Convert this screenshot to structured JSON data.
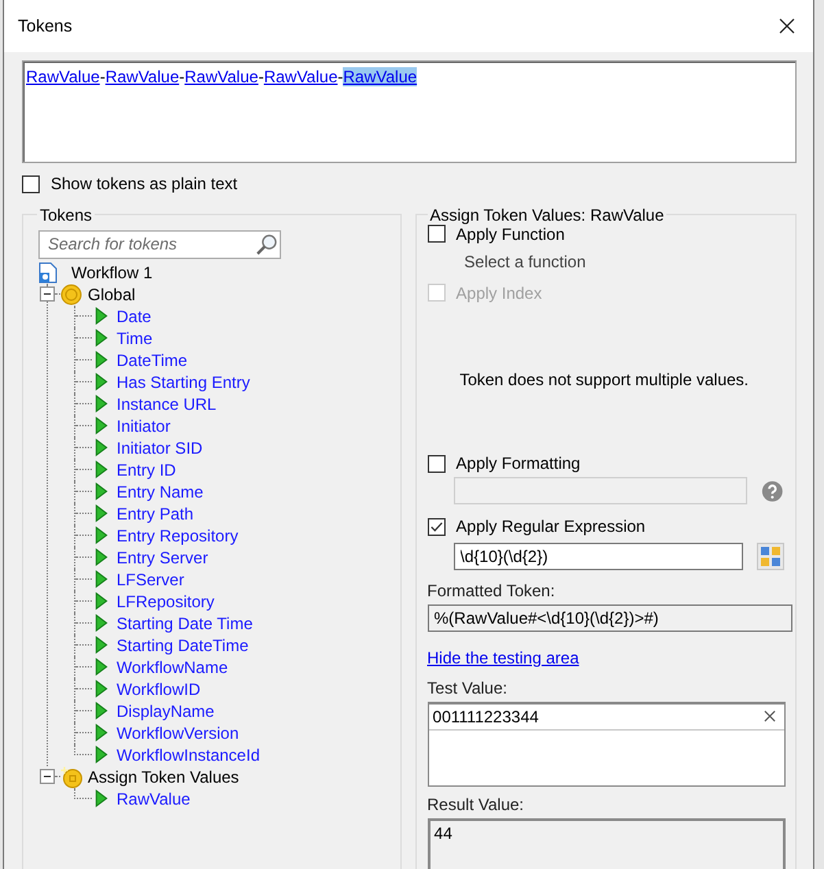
{
  "window": {
    "title": "Tokens"
  },
  "token_expression": [
    {
      "kind": "token",
      "text": "RawValue",
      "selected": false
    },
    {
      "kind": "separator",
      "text": "-"
    },
    {
      "kind": "token",
      "text": "RawValue",
      "selected": false
    },
    {
      "kind": "separator",
      "text": "-"
    },
    {
      "kind": "token",
      "text": "RawValue",
      "selected": false
    },
    {
      "kind": "separator",
      "text": "-"
    },
    {
      "kind": "token",
      "text": "RawValue",
      "selected": false
    },
    {
      "kind": "separator",
      "text": "-"
    },
    {
      "kind": "token",
      "text": "RawValue",
      "selected": true
    }
  ],
  "plain_text_option": {
    "label": "Show tokens as plain text",
    "checked": false
  },
  "tokens_panel": {
    "title": "Tokens",
    "search": {
      "placeholder": "Search for tokens"
    },
    "tree": [
      {
        "kind": "workflow",
        "label": "Workflow 1",
        "children": [
          {
            "kind": "global",
            "label": "Global",
            "expanded": true,
            "children": [
              {
                "kind": "token",
                "label": "Date"
              },
              {
                "kind": "token",
                "label": "Time"
              },
              {
                "kind": "token",
                "label": "DateTime"
              },
              {
                "kind": "token",
                "label": "Has Starting Entry"
              },
              {
                "kind": "token",
                "label": "Instance URL"
              },
              {
                "kind": "token",
                "label": "Initiator"
              },
              {
                "kind": "token",
                "label": "Initiator SID"
              },
              {
                "kind": "token",
                "label": "Entry ID"
              },
              {
                "kind": "token",
                "label": "Entry Name"
              },
              {
                "kind": "token",
                "label": "Entry Path"
              },
              {
                "kind": "token",
                "label": "Entry Repository"
              },
              {
                "kind": "token",
                "label": "Entry Server"
              },
              {
                "kind": "token",
                "label": "LFServer"
              },
              {
                "kind": "token",
                "label": "LFRepository"
              },
              {
                "kind": "token",
                "label": "Starting Date Time"
              },
              {
                "kind": "token",
                "label": "Starting DateTime"
              },
              {
                "kind": "token",
                "label": "WorkflowName"
              },
              {
                "kind": "token",
                "label": "WorkflowID"
              },
              {
                "kind": "token",
                "label": "DisplayName"
              },
              {
                "kind": "token",
                "label": "WorkflowVersion"
              },
              {
                "kind": "token",
                "label": "WorkflowInstanceId"
              }
            ]
          },
          {
            "kind": "assign",
            "label": "Assign Token Values",
            "expanded": true,
            "children": [
              {
                "kind": "token",
                "label": "RawValue"
              }
            ]
          }
        ]
      }
    ]
  },
  "assign_panel": {
    "title": "Assign Token Values: RawValue",
    "apply_function": {
      "label": "Apply Function",
      "checked": false,
      "disabled": false
    },
    "function_hint": "Select a function",
    "apply_index": {
      "label": "Apply Index",
      "checked": false,
      "disabled": true
    },
    "message": "Token does not support multiple values.",
    "apply_formatting": {
      "label": "Apply Formatting",
      "checked": false,
      "disabled": false
    },
    "formatting_field": {
      "disabled": true
    },
    "apply_regex": {
      "label": "Apply Regular Expression",
      "checked": true,
      "disabled": false
    },
    "regex_field": {
      "value": "\\d{10}(\\d{2})"
    },
    "formatted_token": {
      "label": "Formatted Token:",
      "value": "%(RawValue#<\\d{10}(\\d{2})>#)"
    },
    "testing_link": "Hide the testing area",
    "test_value": {
      "label": "Test Value:",
      "value": "001111223344"
    },
    "result_value": {
      "label": "Result Value:",
      "value": "44"
    }
  }
}
